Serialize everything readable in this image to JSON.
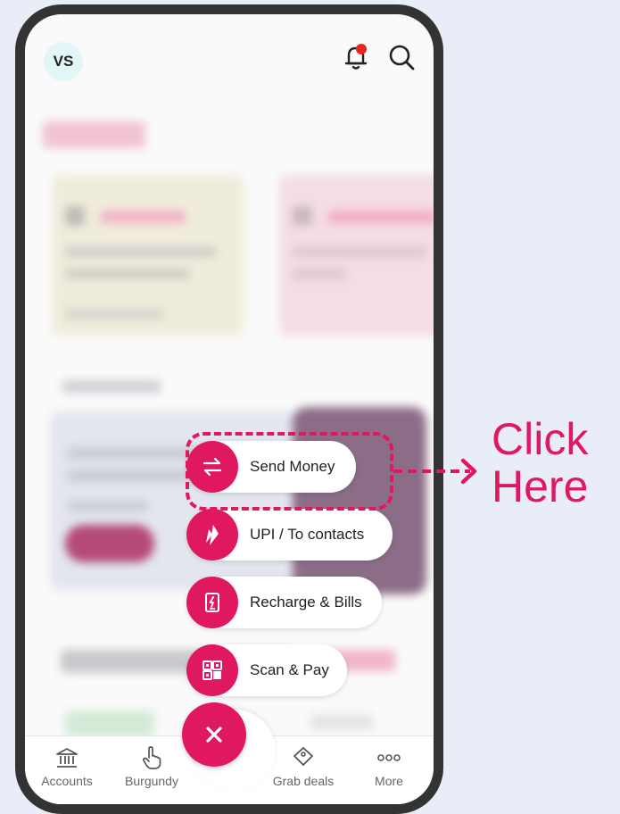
{
  "header": {
    "avatar_initials": "VS",
    "icons": [
      "bell-icon",
      "search-icon"
    ],
    "notification_dot_color": "#e8261e"
  },
  "fab_menu": {
    "items": [
      {
        "label": "Send Money",
        "icon": "transfer-arrows-icon"
      },
      {
        "label": "UPI / To contacts",
        "icon": "upi-icon"
      },
      {
        "label": "Recharge & Bills",
        "icon": "mobile-recharge-icon"
      },
      {
        "label": "Scan & Pay",
        "icon": "qr-code-icon"
      }
    ],
    "close_icon": "close-icon"
  },
  "bottom_nav": {
    "items": [
      {
        "label": "Accounts",
        "icon": "bank-icon"
      },
      {
        "label": "Burgundy",
        "icon": "pointer-hand-icon"
      },
      {
        "label": "Grab deals",
        "icon": "tag-icon"
      },
      {
        "label": "More",
        "icon": "more-dots-icon"
      }
    ]
  },
  "annotation": {
    "text": "Click Here",
    "color": "#e0185f"
  },
  "colors": {
    "accent": "#e0185f",
    "background": "#e9edf8",
    "frame": "#333333"
  }
}
